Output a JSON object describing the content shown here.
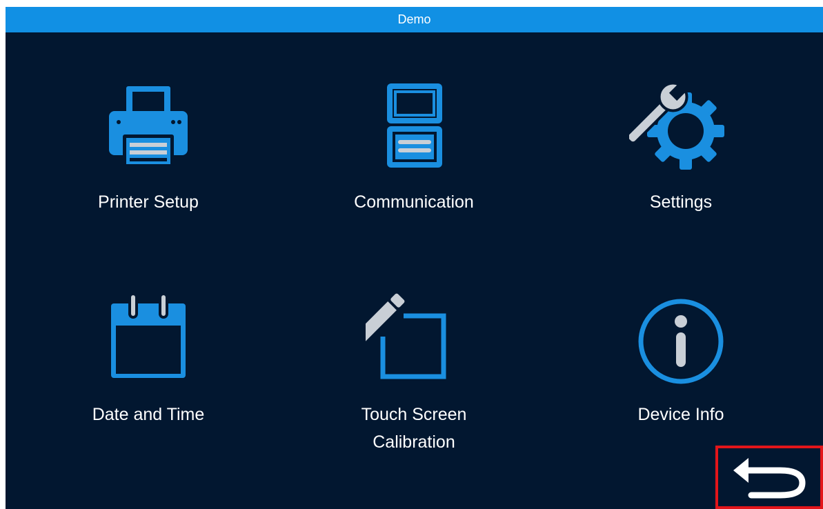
{
  "window": {
    "title": "Demo"
  },
  "menu": {
    "items": [
      {
        "label": "Printer Setup",
        "icon": "printer-icon"
      },
      {
        "label": "Communication",
        "icon": "communication-icon"
      },
      {
        "label": "Settings",
        "icon": "settings-gear-wrench-icon"
      },
      {
        "label": "Date and Time",
        "icon": "calendar-icon"
      },
      {
        "label_line1": "Touch Screen",
        "label_line2": "Calibration",
        "icon": "pen-edit-icon"
      },
      {
        "label": "Device Info",
        "icon": "info-icon"
      }
    ]
  },
  "back_button": {
    "icon": "back-arrow-icon"
  },
  "colors": {
    "background": "#021730",
    "title_bar": "#1190e4",
    "icon_blue": "#1a8fe0",
    "icon_gray": "#c9cfd6",
    "highlight_border": "#e3151a",
    "text": "#ffffff"
  }
}
